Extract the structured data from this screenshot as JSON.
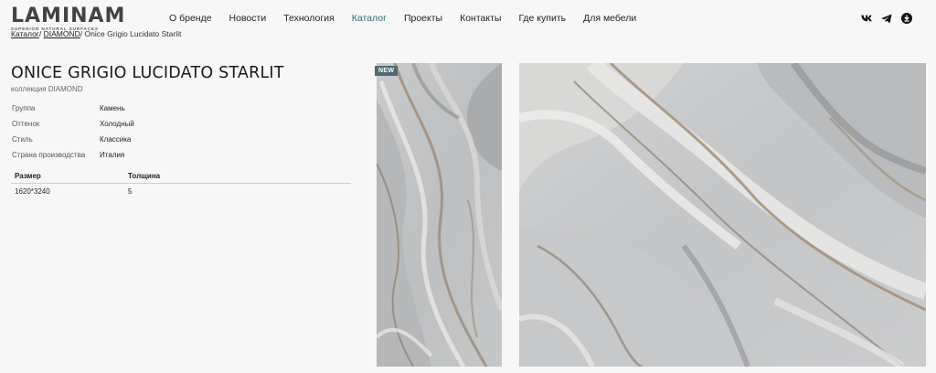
{
  "brand": {
    "name": "LAMINAM",
    "tagline": "SUPERIOR NATURAL SURFACES"
  },
  "nav": [
    {
      "label": "О бренде"
    },
    {
      "label": "Новости"
    },
    {
      "label": "Технология"
    },
    {
      "label": "Каталог",
      "active": true
    },
    {
      "label": "Проекты"
    },
    {
      "label": "Контакты"
    },
    {
      "label": "Где купить"
    },
    {
      "label": "Для мебели"
    }
  ],
  "socials": [
    "vk-icon",
    "telegram-icon",
    "download-icon"
  ],
  "breadcrumb": {
    "catalog": "Каталог",
    "sep1": "/ ",
    "collection": "DIAMOND",
    "sep2": "/ ",
    "current": "Onice Grigio Lucidato Starlit"
  },
  "product": {
    "title": "ONICE GRIGIO LUCIDATO STARLIT",
    "collection": "коллекция DIAMOND",
    "properties": [
      {
        "key": "Группа",
        "value": "Камень"
      },
      {
        "key": "Оттенок",
        "value": "Холодный"
      },
      {
        "key": "Стиль",
        "value": "Классика"
      },
      {
        "key": "Страна производства",
        "value": "Италия"
      }
    ],
    "sizes": {
      "header": {
        "size": "Размер",
        "thickness": "Толщина"
      },
      "rows": [
        {
          "size": "1620*3240",
          "thickness": "5"
        }
      ]
    },
    "badge": "NEW"
  },
  "colors": {
    "accent": "#2f6a70",
    "badge": "#4d6c72",
    "background": "#f7f7f7"
  }
}
